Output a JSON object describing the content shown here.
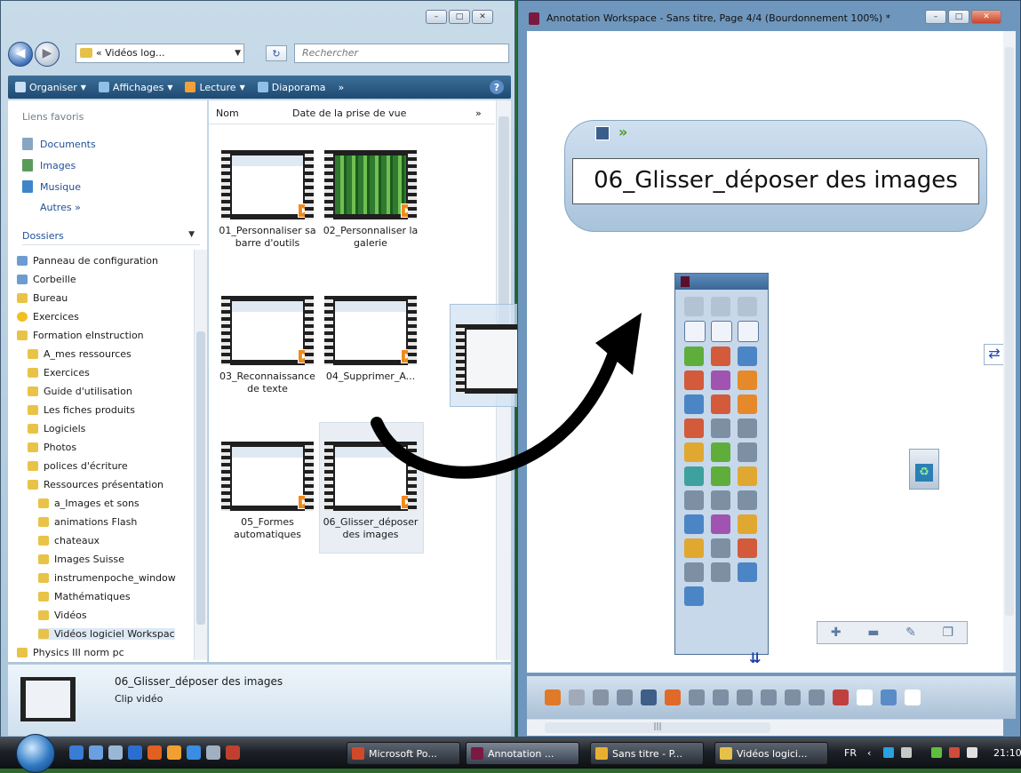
{
  "explorer": {
    "window_controls": [
      "–",
      "□",
      "✕"
    ],
    "address": "« Vidéos log...",
    "search_placeholder": "Rechercher",
    "commands": [
      "Organiser",
      "Affichages",
      "Lecture",
      "Diaporama",
      "»"
    ],
    "favorites_title": "Liens favoris",
    "favorites": [
      "Documents",
      "Images",
      "Musique"
    ],
    "favorites_more": "Autres »",
    "folders_header": "Dossiers",
    "tree": [
      {
        "label": "Panneau de configuration",
        "type": "system"
      },
      {
        "label": "Corbeille",
        "type": "system"
      },
      {
        "label": "Bureau",
        "type": "folder"
      },
      {
        "label": "Exercices",
        "type": "star"
      },
      {
        "label": "Formation eInstruction",
        "type": "folder"
      },
      {
        "label": "A_mes ressources",
        "type": "folder"
      },
      {
        "label": "Exercices",
        "type": "folder"
      },
      {
        "label": "Guide d'utilisation",
        "type": "folder"
      },
      {
        "label": "Les fiches produits",
        "type": "folder"
      },
      {
        "label": "Logiciels",
        "type": "folder"
      },
      {
        "label": "Photos",
        "type": "folder"
      },
      {
        "label": "polices d'écriture",
        "type": "folder"
      },
      {
        "label": "Ressources présentation",
        "type": "folder"
      },
      {
        "label": "a_Images et sons",
        "type": "folder"
      },
      {
        "label": "animations Flash",
        "type": "folder"
      },
      {
        "label": "chateaux",
        "type": "folder"
      },
      {
        "label": "Images Suisse",
        "type": "folder"
      },
      {
        "label": "instrumenpoche_window",
        "type": "folder"
      },
      {
        "label": "Mathématiques",
        "type": "folder"
      },
      {
        "label": "Vidéos",
        "type": "folder"
      },
      {
        "label": "Vidéos logiciel Workspac",
        "type": "folder"
      },
      {
        "label": "Physics III norm pc",
        "type": "folder"
      }
    ],
    "columns": [
      "Nom",
      "Date de la prise de vue",
      "»"
    ],
    "files": [
      {
        "name": "01_Personnaliser sa barre d'outils"
      },
      {
        "name": "02_Personnaliser la galerie"
      },
      {
        "name": "03_Reconnaissance de texte"
      },
      {
        "name": "04_Supprimer_A..."
      },
      {
        "name": "05_Formes automatiques"
      },
      {
        "name": "06_Glisser_déposer des images"
      }
    ],
    "details_name": "06_Glisser_déposer des images",
    "details_type": "Clip vidéo"
  },
  "annotation": {
    "title": "Annotation Workspace - Sans titre, Page 4/4  (Bourdonnement 100%) *",
    "page_title": "06_Glisser_déposer des images"
  },
  "taskbar": {
    "tasks": [
      "Microsoft Po...",
      "Annotation ...",
      "Sans titre - P...",
      "Vidéos logici..."
    ],
    "lang": "FR",
    "time": "21:10"
  }
}
